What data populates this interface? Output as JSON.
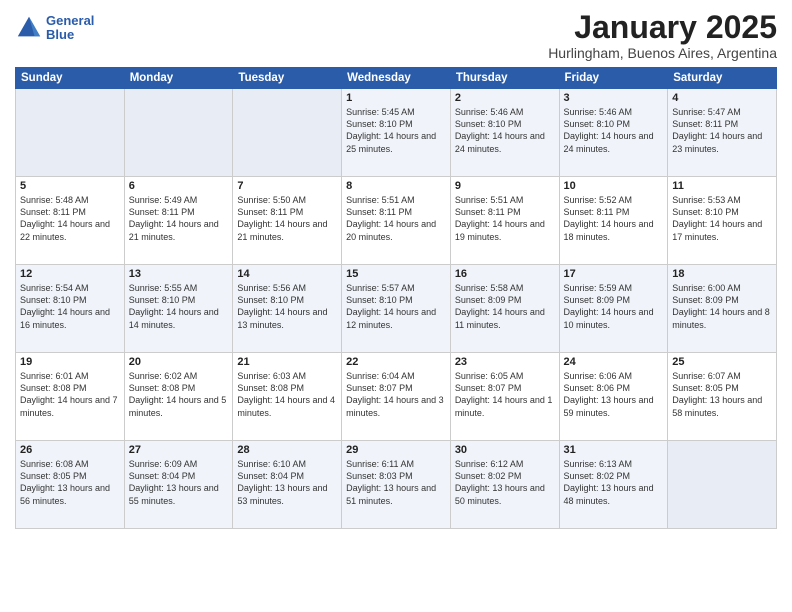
{
  "logo": {
    "line1": "General",
    "line2": "Blue"
  },
  "title": {
    "month_year": "January 2025",
    "location": "Hurlingham, Buenos Aires, Argentina"
  },
  "days_of_week": [
    "Sunday",
    "Monday",
    "Tuesday",
    "Wednesday",
    "Thursday",
    "Friday",
    "Saturday"
  ],
  "weeks": [
    [
      {
        "day": "",
        "info": ""
      },
      {
        "day": "",
        "info": ""
      },
      {
        "day": "",
        "info": ""
      },
      {
        "day": "1",
        "info": "Sunrise: 5:45 AM\nSunset: 8:10 PM\nDaylight: 14 hours\nand 25 minutes."
      },
      {
        "day": "2",
        "info": "Sunrise: 5:46 AM\nSunset: 8:10 PM\nDaylight: 14 hours\nand 24 minutes."
      },
      {
        "day": "3",
        "info": "Sunrise: 5:46 AM\nSunset: 8:10 PM\nDaylight: 14 hours\nand 24 minutes."
      },
      {
        "day": "4",
        "info": "Sunrise: 5:47 AM\nSunset: 8:11 PM\nDaylight: 14 hours\nand 23 minutes."
      }
    ],
    [
      {
        "day": "5",
        "info": "Sunrise: 5:48 AM\nSunset: 8:11 PM\nDaylight: 14 hours\nand 22 minutes."
      },
      {
        "day": "6",
        "info": "Sunrise: 5:49 AM\nSunset: 8:11 PM\nDaylight: 14 hours\nand 21 minutes."
      },
      {
        "day": "7",
        "info": "Sunrise: 5:50 AM\nSunset: 8:11 PM\nDaylight: 14 hours\nand 21 minutes."
      },
      {
        "day": "8",
        "info": "Sunrise: 5:51 AM\nSunset: 8:11 PM\nDaylight: 14 hours\nand 20 minutes."
      },
      {
        "day": "9",
        "info": "Sunrise: 5:51 AM\nSunset: 8:11 PM\nDaylight: 14 hours\nand 19 minutes."
      },
      {
        "day": "10",
        "info": "Sunrise: 5:52 AM\nSunset: 8:11 PM\nDaylight: 14 hours\nand 18 minutes."
      },
      {
        "day": "11",
        "info": "Sunrise: 5:53 AM\nSunset: 8:10 PM\nDaylight: 14 hours\nand 17 minutes."
      }
    ],
    [
      {
        "day": "12",
        "info": "Sunrise: 5:54 AM\nSunset: 8:10 PM\nDaylight: 14 hours\nand 16 minutes."
      },
      {
        "day": "13",
        "info": "Sunrise: 5:55 AM\nSunset: 8:10 PM\nDaylight: 14 hours\nand 14 minutes."
      },
      {
        "day": "14",
        "info": "Sunrise: 5:56 AM\nSunset: 8:10 PM\nDaylight: 14 hours\nand 13 minutes."
      },
      {
        "day": "15",
        "info": "Sunrise: 5:57 AM\nSunset: 8:10 PM\nDaylight: 14 hours\nand 12 minutes."
      },
      {
        "day": "16",
        "info": "Sunrise: 5:58 AM\nSunset: 8:09 PM\nDaylight: 14 hours\nand 11 minutes."
      },
      {
        "day": "17",
        "info": "Sunrise: 5:59 AM\nSunset: 8:09 PM\nDaylight: 14 hours\nand 10 minutes."
      },
      {
        "day": "18",
        "info": "Sunrise: 6:00 AM\nSunset: 8:09 PM\nDaylight: 14 hours\nand 8 minutes."
      }
    ],
    [
      {
        "day": "19",
        "info": "Sunrise: 6:01 AM\nSunset: 8:08 PM\nDaylight: 14 hours\nand 7 minutes."
      },
      {
        "day": "20",
        "info": "Sunrise: 6:02 AM\nSunset: 8:08 PM\nDaylight: 14 hours\nand 5 minutes."
      },
      {
        "day": "21",
        "info": "Sunrise: 6:03 AM\nSunset: 8:08 PM\nDaylight: 14 hours\nand 4 minutes."
      },
      {
        "day": "22",
        "info": "Sunrise: 6:04 AM\nSunset: 8:07 PM\nDaylight: 14 hours\nand 3 minutes."
      },
      {
        "day": "23",
        "info": "Sunrise: 6:05 AM\nSunset: 8:07 PM\nDaylight: 14 hours\nand 1 minute."
      },
      {
        "day": "24",
        "info": "Sunrise: 6:06 AM\nSunset: 8:06 PM\nDaylight: 13 hours\nand 59 minutes."
      },
      {
        "day": "25",
        "info": "Sunrise: 6:07 AM\nSunset: 8:05 PM\nDaylight: 13 hours\nand 58 minutes."
      }
    ],
    [
      {
        "day": "26",
        "info": "Sunrise: 6:08 AM\nSunset: 8:05 PM\nDaylight: 13 hours\nand 56 minutes."
      },
      {
        "day": "27",
        "info": "Sunrise: 6:09 AM\nSunset: 8:04 PM\nDaylight: 13 hours\nand 55 minutes."
      },
      {
        "day": "28",
        "info": "Sunrise: 6:10 AM\nSunset: 8:04 PM\nDaylight: 13 hours\nand 53 minutes."
      },
      {
        "day": "29",
        "info": "Sunrise: 6:11 AM\nSunset: 8:03 PM\nDaylight: 13 hours\nand 51 minutes."
      },
      {
        "day": "30",
        "info": "Sunrise: 6:12 AM\nSunset: 8:02 PM\nDaylight: 13 hours\nand 50 minutes."
      },
      {
        "day": "31",
        "info": "Sunrise: 6:13 AM\nSunset: 8:02 PM\nDaylight: 13 hours\nand 48 minutes."
      },
      {
        "day": "",
        "info": ""
      }
    ]
  ]
}
